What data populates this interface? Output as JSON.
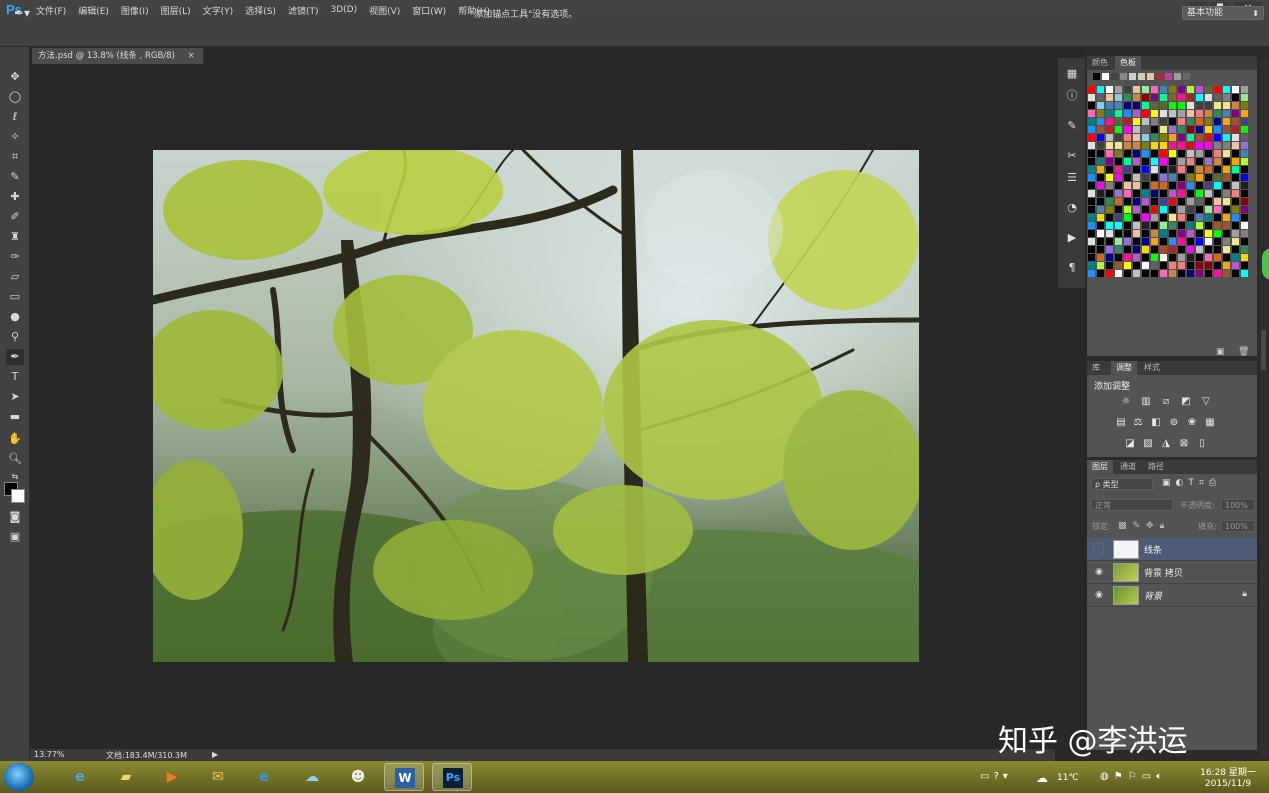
{
  "app": {
    "logo": "Ps",
    "menus": [
      "文件(F)",
      "编辑(E)",
      "图像(I)",
      "图层(L)",
      "文字(Y)",
      "选择(S)",
      "滤镜(T)",
      "3D(D)",
      "视图(V)",
      "窗口(W)",
      "帮助(H)"
    ],
    "window_controls": [
      "▬",
      "◘",
      "✕"
    ]
  },
  "options_bar": {
    "hint": "\"添加锚点工具\"没有选项。",
    "workspace": "基本功能"
  },
  "document": {
    "tab_title": "方法.psd @ 13.8% (线条 , RGB/8)",
    "tab_close": "×"
  },
  "status": {
    "zoom": "13.77%",
    "doc_size": "文档:183.4M/310.3M",
    "arrow": "▶"
  },
  "panels": {
    "color_tabs": [
      "颜色",
      "色板"
    ],
    "adjust_tabs": [
      "库",
      "调整",
      "样式"
    ],
    "adjust_title": "添加调整",
    "layer_tabs": [
      "图层",
      "通道",
      "路径"
    ],
    "layer_filter": "ρ 类型",
    "blend_mode": "正常",
    "opacity_label": "不透明度:",
    "opacity_value": "100%",
    "lock_label": "锁定:",
    "fill_label": "填充:",
    "fill_value": "100%"
  },
  "layers": [
    {
      "name": "线条",
      "visible": false,
      "selected": true,
      "locked": false
    },
    {
      "name": "背景 拷贝",
      "visible": true,
      "selected": false,
      "locked": false
    },
    {
      "name": "背景",
      "visible": true,
      "selected": false,
      "locked": true
    }
  ],
  "watermark": "知乎 @李洪运",
  "taskbar": {
    "temperature": "11℃",
    "time": "16:28 星期一",
    "date": "2015/11/9"
  },
  "colors": {
    "accent": "#31a8ff",
    "selected_layer": "#4d5b76"
  }
}
